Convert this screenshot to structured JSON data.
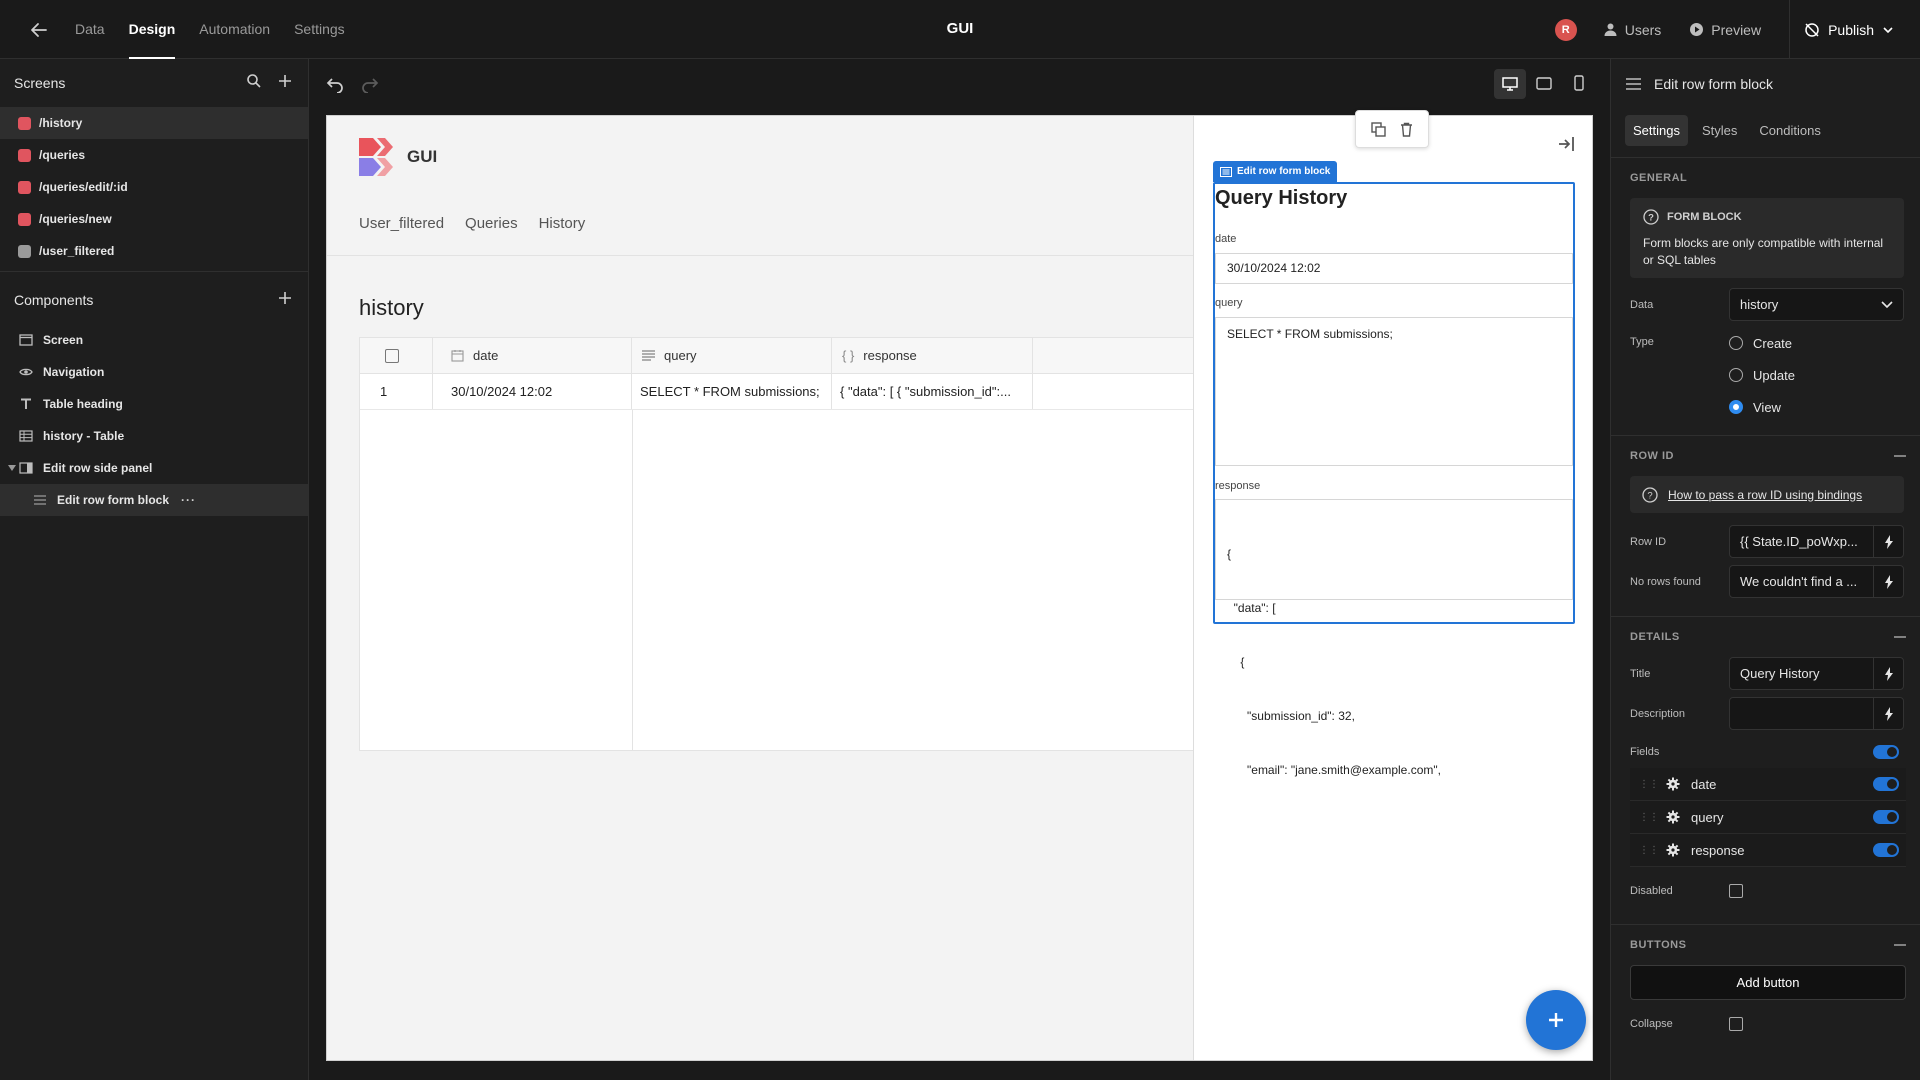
{
  "topbar": {
    "nav": [
      "Data",
      "Design",
      "Automation",
      "Settings"
    ],
    "active": "Design",
    "app_title": "GUI",
    "avatar_initial": "R",
    "users_label": "Users",
    "preview_label": "Preview",
    "publish_label": "Publish"
  },
  "screens": {
    "title": "Screens",
    "items": [
      {
        "label": "/history",
        "color": "#e0555f"
      },
      {
        "label": "/queries",
        "color": "#e0555f"
      },
      {
        "label": "/queries/edit/:id",
        "color": "#e0555f"
      },
      {
        "label": "/queries/new",
        "color": "#e0555f"
      },
      {
        "label": "/user_filtered",
        "color": "#9a9a9a"
      }
    ]
  },
  "components": {
    "title": "Components",
    "items": [
      {
        "label": "Screen",
        "icon": "screen-icon"
      },
      {
        "label": "Navigation",
        "icon": "eye-icon"
      },
      {
        "label": "Table heading",
        "icon": "text-icon"
      },
      {
        "label": "history - Table",
        "icon": "table-icon"
      },
      {
        "label": "Edit row side panel",
        "icon": "side-panel-icon"
      },
      {
        "label": "Edit row form block",
        "icon": "form-icon"
      }
    ]
  },
  "preview": {
    "app_name": "GUI",
    "nav": [
      "User_filtered",
      "Queries",
      "History"
    ],
    "page_heading": "history",
    "table": {
      "columns": [
        {
          "label": "date",
          "icon": "calendar-icon"
        },
        {
          "label": "query",
          "icon": "text-lines-icon"
        },
        {
          "label": "response",
          "icon": "braces-icon"
        }
      ],
      "rows": [
        {
          "index": "1",
          "date": "30/10/2024 12:02",
          "query": "SELECT * FROM submissions;",
          "response": "{ \"data\": [ { \"submission_id\":..."
        }
      ]
    },
    "form": {
      "tag": "Edit row form block",
      "title": "Query History",
      "fields": [
        {
          "label": "date",
          "value": "30/10/2024 12:02"
        },
        {
          "label": "query",
          "value": "SELECT * FROM submissions;"
        },
        {
          "label": "response",
          "lines": [
            "{",
            "  \"data\": [",
            "    {",
            "      \"submission_id\": 32,",
            "      \"email\": \"jane.smith@example.com\","
          ]
        }
      ]
    }
  },
  "settings": {
    "header": "Edit row form block",
    "tabs": [
      "Settings",
      "Styles",
      "Conditions"
    ],
    "general": {
      "title": "GENERAL",
      "info_title": "FORM BLOCK",
      "info_text": "Form blocks are only compatible with internal or SQL tables",
      "data_label": "Data",
      "data_value": "history",
      "type_label": "Type",
      "types": [
        "Create",
        "Update",
        "View"
      ],
      "type_selected": "View"
    },
    "row_id": {
      "title": "ROW ID",
      "help_link": "How to pass a row ID using bindings",
      "row_id_label": "Row ID",
      "row_id_value": "{{ State.ID_poWxp...",
      "no_rows_label": "No rows found",
      "no_rows_value": "We couldn't find a ..."
    },
    "details": {
      "title": "DETAILS",
      "title_label": "Title",
      "title_value": "Query History",
      "description_label": "Description",
      "description_value": "",
      "fields_label": "Fields",
      "fields": [
        "date",
        "query",
        "response"
      ],
      "disabled_label": "Disabled"
    },
    "buttons": {
      "title": "BUTTONS",
      "add_button": "Add button",
      "collapse_label": "Collapse"
    }
  }
}
